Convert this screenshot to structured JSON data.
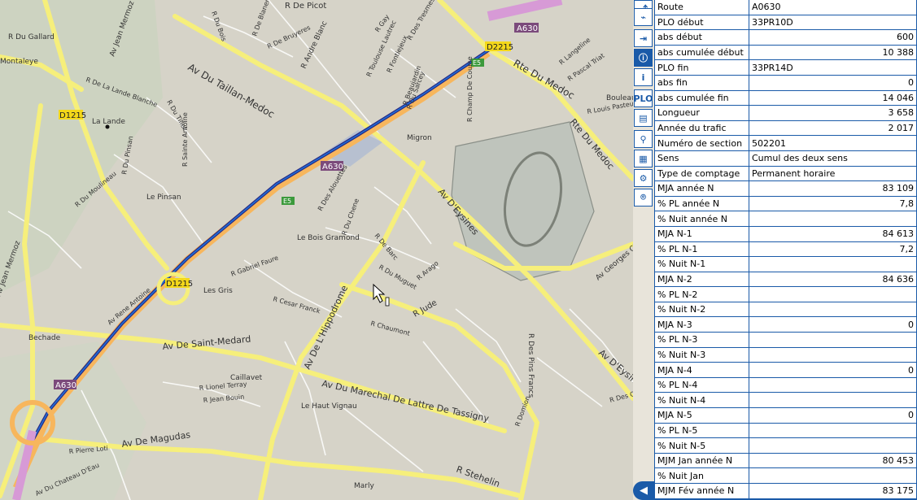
{
  "map": {
    "labels": [
      "R De Picot",
      "R Du Gallard",
      "R Du Bois",
      "Montaleye",
      "Av Jean Mermoz",
      "R De La Lande Blanche",
      "R Andre Blanc",
      "R De Bruyeres",
      "R De Blanerad",
      "R Toulouse Lautrec",
      "R Fontiejeux",
      "R Des Tresmes",
      "R Gay",
      "R Langeline",
      "R Pascal Triat",
      "R Beaujardin",
      "Av Du Taillan-Medoc",
      "Rte Du Medoc",
      "Bouleau",
      "R Louis Pasteur",
      "La Lande",
      "R Du Tillet",
      "D1215",
      "R Du Sarcey",
      "R Champ De Course",
      "Migron",
      "R Sainte Antoine",
      "R Du Pinsan",
      "R Du Moulineau",
      "Le Pinsan",
      "R Des Alouettes",
      "Av D'Eysines",
      "Rte Du Medoc",
      "Le Bois Gramond",
      "R De Barc",
      "Av Georges Clemenceau",
      "R Du Chene",
      "Av Jean Mermoz",
      "R Gabriel Faure",
      "Les Gris",
      "R Du Muguet",
      "R Arago",
      "R Cesar Franck",
      "Av Rene Antoine",
      "R Jude",
      "Av De Saint-Medard",
      "R Chaumont",
      "Av De L'Hippodrome",
      "Bechade",
      "Av D'Eysines",
      "Caillavet",
      "Av Du Marechal De Lattre De Tassigny",
      "R Des Pins Francs",
      "R Lionel Terray",
      "R Jean Bouin",
      "Le Haut Vignau",
      "R Des Orangers",
      "Av De Magudas",
      "R Stehelin",
      "R Domion",
      "R Pierre Loti",
      "Marly",
      "Av Du Chateau D'Eau"
    ],
    "road_shields": [
      "A630",
      "D2215",
      "D1215",
      "A630",
      "D1215",
      "A630",
      "E5",
      "E5",
      "E5"
    ]
  },
  "toolbar": {
    "buttons": [
      {
        "name": "route-icon",
        "glyph": "⤴"
      },
      {
        "name": "pdf-icon",
        "glyph": "⌁"
      },
      {
        "name": "export-icon",
        "glyph": "⇥"
      },
      {
        "name": "info-circle-icon",
        "glyph": "ⓘ"
      },
      {
        "name": "info-box-icon",
        "glyph": "i"
      },
      {
        "name": "plo-button",
        "glyph": "PLO"
      },
      {
        "name": "ruler-icon",
        "glyph": "▤"
      },
      {
        "name": "search-icon",
        "glyph": "⚲"
      },
      {
        "name": "layers-icon",
        "glyph": "▦"
      },
      {
        "name": "gear-icon",
        "glyph": "⚙"
      },
      {
        "name": "camera-icon",
        "glyph": "⌾"
      }
    ],
    "collapse_glyph": "◀"
  },
  "panel": {
    "rows": [
      {
        "label": "Route",
        "value": "A0630",
        "num": false
      },
      {
        "label": "PLO début",
        "value": "33PR10D",
        "num": false
      },
      {
        "label": "abs début",
        "value": "600",
        "num": true
      },
      {
        "label": "abs cumulée début",
        "value": "10 388",
        "num": true
      },
      {
        "label": "PLO fin",
        "value": "33PR14D",
        "num": false
      },
      {
        "label": "abs fin",
        "value": "0",
        "num": true
      },
      {
        "label": "abs cumulée fin",
        "value": "14 046",
        "num": true
      },
      {
        "label": "Longueur",
        "value": "3 658",
        "num": true
      },
      {
        "label": "Année du trafic",
        "value": "2 017",
        "num": true
      },
      {
        "label": "Numéro de section",
        "value": "502201",
        "num": false
      },
      {
        "label": "Sens",
        "value": "Cumul des deux sens",
        "num": false
      },
      {
        "label": "Type de comptage",
        "value": "Permanent horaire",
        "num": false
      },
      {
        "label": "MJA année N",
        "value": "83 109",
        "num": true
      },
      {
        "label": "% PL année N",
        "value": "7,8",
        "num": true
      },
      {
        "label": "% Nuit année N",
        "value": "",
        "num": true
      },
      {
        "label": "MJA N-1",
        "value": "84 613",
        "num": true
      },
      {
        "label": "% PL N-1",
        "value": "7,2",
        "num": true
      },
      {
        "label": "% Nuit N-1",
        "value": "",
        "num": true
      },
      {
        "label": "MJA N-2",
        "value": "84 636",
        "num": true
      },
      {
        "label": "% PL N-2",
        "value": "",
        "num": true
      },
      {
        "label": "% Nuit N-2",
        "value": "",
        "num": true
      },
      {
        "label": "MJA N-3",
        "value": "0",
        "num": true
      },
      {
        "label": "% PL N-3",
        "value": "",
        "num": true
      },
      {
        "label": "% Nuit N-3",
        "value": "",
        "num": true
      },
      {
        "label": "MJA N-4",
        "value": "0",
        "num": true
      },
      {
        "label": "% PL N-4",
        "value": "",
        "num": true
      },
      {
        "label": "% Nuit N-4",
        "value": "",
        "num": true
      },
      {
        "label": "MJA N-5",
        "value": "0",
        "num": true
      },
      {
        "label": "% PL N-5",
        "value": "",
        "num": true
      },
      {
        "label": "% Nuit N-5",
        "value": "",
        "num": true
      },
      {
        "label": "MJM Jan année N",
        "value": "80 453",
        "num": true
      },
      {
        "label": "% Nuit Jan",
        "value": "",
        "num": true
      },
      {
        "label": "MJM Fév année N",
        "value": "83 175",
        "num": true
      }
    ]
  }
}
